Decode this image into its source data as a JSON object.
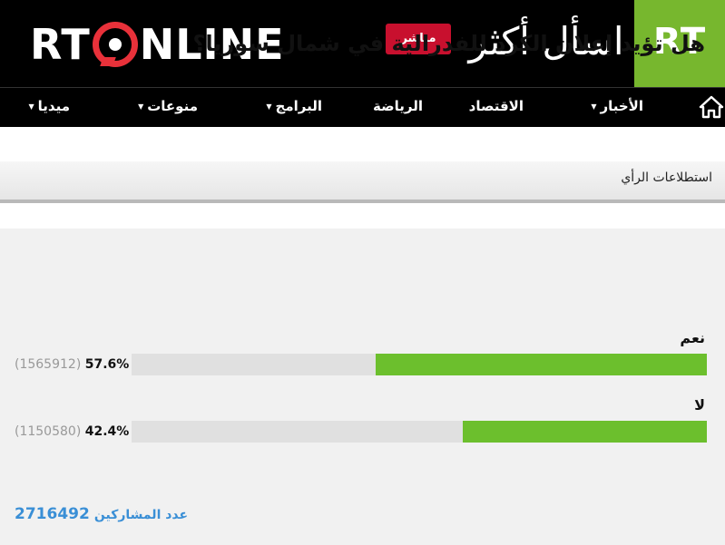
{
  "header": {
    "logo_left": "RT",
    "logo_right": "NLINE",
    "live_label": "مباشر",
    "slogan": "اسأل أكثر",
    "brand": "RT"
  },
  "nav": {
    "items": [
      {
        "label": "الأخبار",
        "has_menu": true
      },
      {
        "label": "الاقتصاد",
        "has_menu": false
      },
      {
        "label": "الرياضة",
        "has_menu": false
      },
      {
        "label": "البرامج",
        "has_menu": true
      },
      {
        "label": "منوعات",
        "has_menu": true
      },
      {
        "label": "ميديا",
        "has_menu": true
      }
    ]
  },
  "section": {
    "title": "استطلاعات الرأي"
  },
  "poll": {
    "question": "هل تؤيد إعلان الكرد للفدرالية في شمال سوريا؟",
    "options": [
      {
        "label": "نعم",
        "percent": "57.6%",
        "votes": "(1565912)",
        "fraction": 0.576
      },
      {
        "label": "لا",
        "percent": "42.4%",
        "votes": "(1150580)",
        "fraction": 0.424
      }
    ],
    "participants_label": "عدد المشاركين",
    "participants_count": "2716492"
  },
  "colors": {
    "accent_green": "#6cbf2d",
    "live_red": "#c8102e",
    "link_blue": "#3a8fd6"
  }
}
